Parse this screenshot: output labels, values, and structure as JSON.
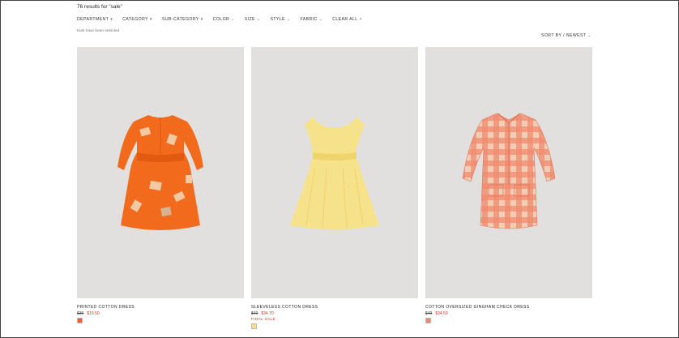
{
  "search": {
    "results_text": "76 results for \"sale\""
  },
  "filters": [
    {
      "label": "DEPARTMENT",
      "icon": "caret-down"
    },
    {
      "label": "CATEGORY",
      "icon": "caret-down"
    },
    {
      "label": "SUB-CATEGORY",
      "icon": "caret-down"
    },
    {
      "label": "COLOR",
      "icon": "chevron-down"
    },
    {
      "label": "SIZE",
      "icon": "chevron-down"
    },
    {
      "label": "STYLE",
      "icon": "chevron-down"
    },
    {
      "label": "FABRIC",
      "icon": "chevron-down"
    },
    {
      "label": "CLEAR ALL",
      "icon": "close"
    }
  ],
  "status": {
    "text": "Kids have been selected"
  },
  "sort": {
    "label": "SORT BY / NEWEST",
    "icon": "chevron-down"
  },
  "products": [
    {
      "name": "PRINTED COTTON DRESS",
      "old_price": "$39",
      "sale_price": "$19.50",
      "final_sale": "",
      "swatch_color": "#e8622a",
      "dress_color": "#f26b1d",
      "accent_color": "#f2c9a3"
    },
    {
      "name": "SLEEVELESS COTTON DRESS",
      "old_price": "$49",
      "sale_price": "$34.70",
      "final_sale": "FINAL SALE",
      "swatch_color": "#f3dc8a",
      "dress_color": "#f6e28a",
      "accent_color": "#efd36b"
    },
    {
      "name": "COTTON OVERSIZED GINGHAM CHECK DRESS",
      "old_price": "$49",
      "sale_price": "$34.50",
      "final_sale": "",
      "swatch_color": "#ec8a6c",
      "dress_color": "#f08a6e",
      "accent_color": "#e9c3a8"
    }
  ]
}
